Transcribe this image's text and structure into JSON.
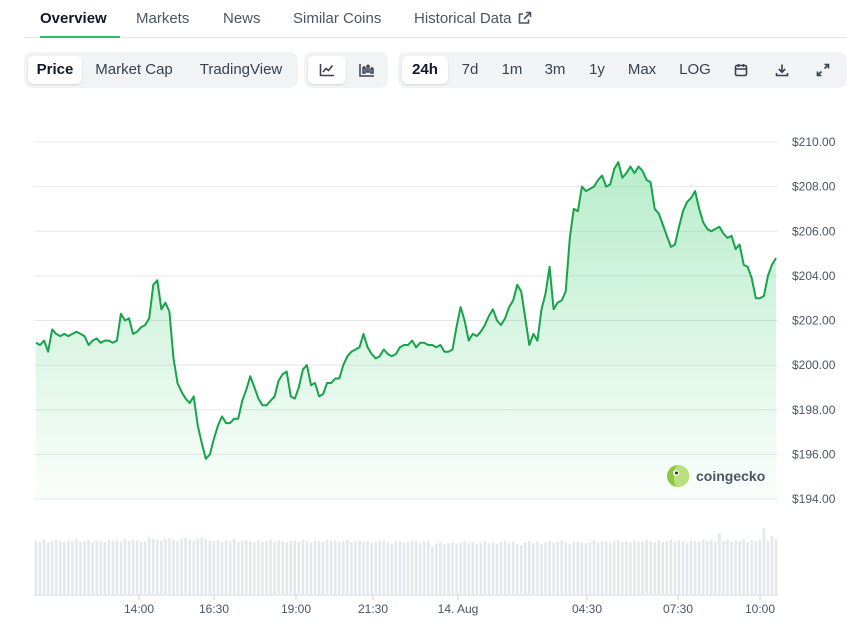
{
  "tabs": [
    {
      "label": "Overview",
      "active": true
    },
    {
      "label": "Markets",
      "active": false
    },
    {
      "label": "News",
      "active": false
    },
    {
      "label": "Similar Coins",
      "active": false
    },
    {
      "label": "Historical Data",
      "active": false,
      "icon": "external-link-icon"
    }
  ],
  "toolbar": {
    "views": [
      "Price",
      "Market Cap",
      "TradingView"
    ],
    "selected_view": "Price",
    "chart_types": [
      {
        "icon": "line-chart-icon",
        "selected": true
      },
      {
        "icon": "candlestick-chart-icon",
        "selected": false
      }
    ],
    "ranges": [
      "24h",
      "7d",
      "1m",
      "3m",
      "1y",
      "Max",
      "LOG"
    ],
    "selected_range": "24h",
    "actions": [
      "calendar-icon",
      "download-icon",
      "fullscreen-icon"
    ]
  },
  "watermark": {
    "text": "coingecko",
    "icon": "coingecko-logo-icon"
  },
  "colors": {
    "line": "#16a34a",
    "accent": "#22c55e",
    "volume": "#e5e7eb",
    "grid": "#e5e7eb"
  },
  "chart_data": {
    "type": "area",
    "series_unit": "USD",
    "y_ticks": [
      "$210.00",
      "$208.00",
      "$206.00",
      "$204.00",
      "$202.00",
      "$200.00",
      "$198.00",
      "$196.00",
      "$194.00"
    ],
    "ylim": [
      194,
      210
    ],
    "x_ticks": [
      "14:00",
      "16:30",
      "19:00",
      "21:30",
      "14. Aug",
      "04:30",
      "07:30",
      "10:00"
    ],
    "grid": true,
    "legend": "none",
    "prices": [
      201.0,
      200.9,
      201.1,
      200.6,
      201.6,
      201.4,
      201.3,
      201.4,
      201.3,
      201.4,
      201.5,
      201.4,
      201.3,
      200.9,
      201.1,
      201.2,
      201.0,
      201.1,
      201.1,
      201.0,
      201.1,
      202.3,
      202.0,
      202.1,
      201.4,
      201.5,
      201.7,
      201.8,
      202.1,
      203.6,
      203.8,
      202.5,
      202.8,
      202.4,
      200.3,
      199.2,
      198.8,
      198.5,
      198.3,
      198.6,
      197.3,
      196.5,
      195.8,
      196.0,
      196.7,
      197.3,
      197.7,
      197.4,
      197.4,
      197.6,
      197.6,
      198.4,
      198.9,
      199.5,
      199.0,
      198.5,
      198.2,
      198.2,
      198.4,
      198.6,
      199.3,
      199.6,
      199.7,
      198.6,
      198.5,
      199.0,
      199.8,
      200.0,
      199.1,
      199.2,
      198.6,
      198.7,
      199.2,
      199.2,
      199.4,
      199.4,
      200.0,
      200.4,
      200.6,
      200.7,
      200.8,
      201.4,
      200.8,
      200.5,
      200.3,
      200.4,
      200.7,
      200.5,
      200.4,
      200.5,
      200.8,
      200.9,
      200.9,
      201.1,
      200.8,
      201.0,
      201.0,
      200.9,
      200.9,
      200.8,
      200.9,
      200.6,
      200.6,
      200.7,
      201.7,
      202.6,
      202.0,
      201.1,
      201.4,
      201.3,
      201.5,
      201.8,
      202.2,
      202.5,
      202.0,
      201.8,
      202.1,
      202.6,
      202.9,
      203.6,
      203.3,
      202.1,
      200.9,
      201.4,
      201.1,
      202.5,
      203.2,
      204.4,
      202.5,
      202.8,
      202.9,
      203.3,
      205.7,
      207.0,
      206.9,
      208.0,
      207.8,
      207.9,
      208.0,
      208.3,
      208.5,
      208.0,
      208.1,
      208.8,
      209.1,
      208.4,
      208.6,
      208.9,
      208.6,
      208.9,
      208.7,
      208.3,
      208.2,
      207.0,
      206.8,
      206.3,
      205.8,
      205.3,
      205.4,
      206.2,
      206.9,
      207.3,
      207.5,
      207.8,
      207.0,
      206.4,
      206.1,
      206.0,
      206.1,
      206.2,
      205.9,
      205.7,
      205.8,
      205.2,
      205.4,
      204.5,
      204.4,
      203.9,
      203.0,
      203.0,
      203.1,
      204.0,
      204.5,
      204.8
    ],
    "volume_rel": [
      0.81,
      0.79,
      0.83,
      0.78,
      0.8,
      0.82,
      0.8,
      0.79,
      0.81,
      0.8,
      0.83,
      0.79,
      0.8,
      0.82,
      0.78,
      0.81,
      0.8,
      0.79,
      0.82,
      0.8,
      0.81,
      0.79,
      0.83,
      0.8,
      0.82,
      0.81,
      0.79,
      0.8,
      0.85,
      0.84,
      0.82,
      0.81,
      0.83,
      0.84,
      0.82,
      0.8,
      0.83,
      0.85,
      0.82,
      0.81,
      0.84,
      0.86,
      0.83,
      0.81,
      0.8,
      0.82,
      0.79,
      0.81,
      0.8,
      0.83,
      0.79,
      0.81,
      0.82,
      0.8,
      0.78,
      0.81,
      0.79,
      0.8,
      0.82,
      0.79,
      0.81,
      0.8,
      0.78,
      0.8,
      0.81,
      0.79,
      0.82,
      0.8,
      0.78,
      0.81,
      0.8,
      0.79,
      0.82,
      0.8,
      0.81,
      0.79,
      0.8,
      0.82,
      0.78,
      0.8,
      0.81,
      0.79,
      0.8,
      0.77,
      0.79,
      0.81,
      0.8,
      0.78,
      0.76,
      0.79,
      0.8,
      0.78,
      0.79,
      0.81,
      0.8,
      0.77,
      0.79,
      0.8,
      0.72,
      0.76,
      0.78,
      0.75,
      0.77,
      0.79,
      0.76,
      0.78,
      0.8,
      0.77,
      0.79,
      0.76,
      0.78,
      0.8,
      0.77,
      0.79,
      0.76,
      0.78,
      0.8,
      0.77,
      0.79,
      0.76,
      0.74,
      0.78,
      0.8,
      0.77,
      0.79,
      0.76,
      0.78,
      0.8,
      0.77,
      0.79,
      0.81,
      0.78,
      0.76,
      0.79,
      0.8,
      0.78,
      0.77,
      0.79,
      0.81,
      0.78,
      0.8,
      0.79,
      0.77,
      0.8,
      0.82,
      0.79,
      0.8,
      0.78,
      0.81,
      0.8,
      0.79,
      0.82,
      0.8,
      0.78,
      0.81,
      0.79,
      0.8,
      0.82,
      0.79,
      0.81,
      0.8,
      0.78,
      0.81,
      0.8,
      0.79,
      0.82,
      0.8,
      0.81,
      0.79,
      0.92,
      0.8,
      0.82,
      0.79,
      0.81,
      0.8,
      0.83,
      0.79,
      0.81,
      0.8,
      0.82,
      1.0,
      0.81,
      0.88,
      0.83
    ]
  }
}
